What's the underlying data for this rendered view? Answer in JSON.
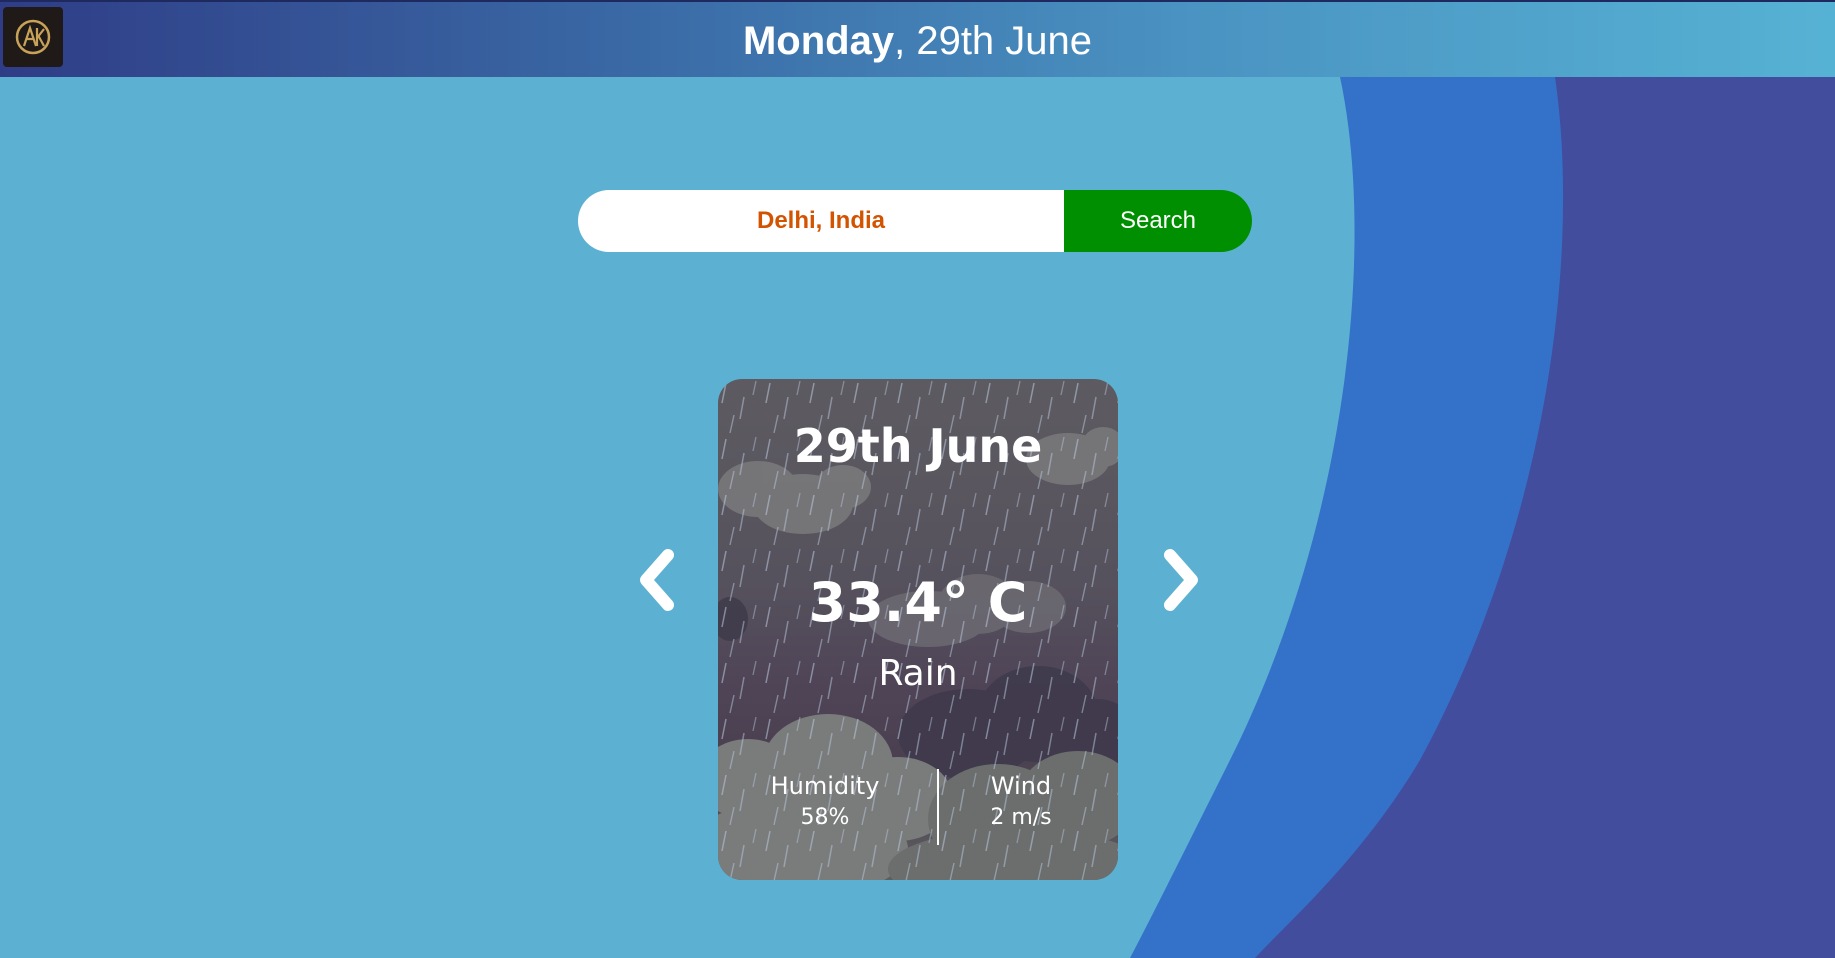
{
  "header": {
    "day": "Monday",
    "date_rest": ", 29th June",
    "logo_icon": "ak-logo-icon"
  },
  "search": {
    "value": "Delhi, India",
    "button_label": "Search"
  },
  "nav": {
    "prev_icon": "chevron-left-icon",
    "next_icon": "chevron-right-icon"
  },
  "card": {
    "date": "29th June",
    "temperature": "33.4° C",
    "condition": "Rain",
    "humidity_label": "Humidity",
    "humidity_value": "58%",
    "wind_label": "Wind",
    "wind_value": "2 m/s",
    "background_icon": "rain-clouds-icon"
  },
  "colors": {
    "background": "#5cb1d3",
    "wave_mid": "#3472c9",
    "wave_outer": "#434d9e",
    "search_button": "#008f00",
    "search_text": "#d35400"
  }
}
